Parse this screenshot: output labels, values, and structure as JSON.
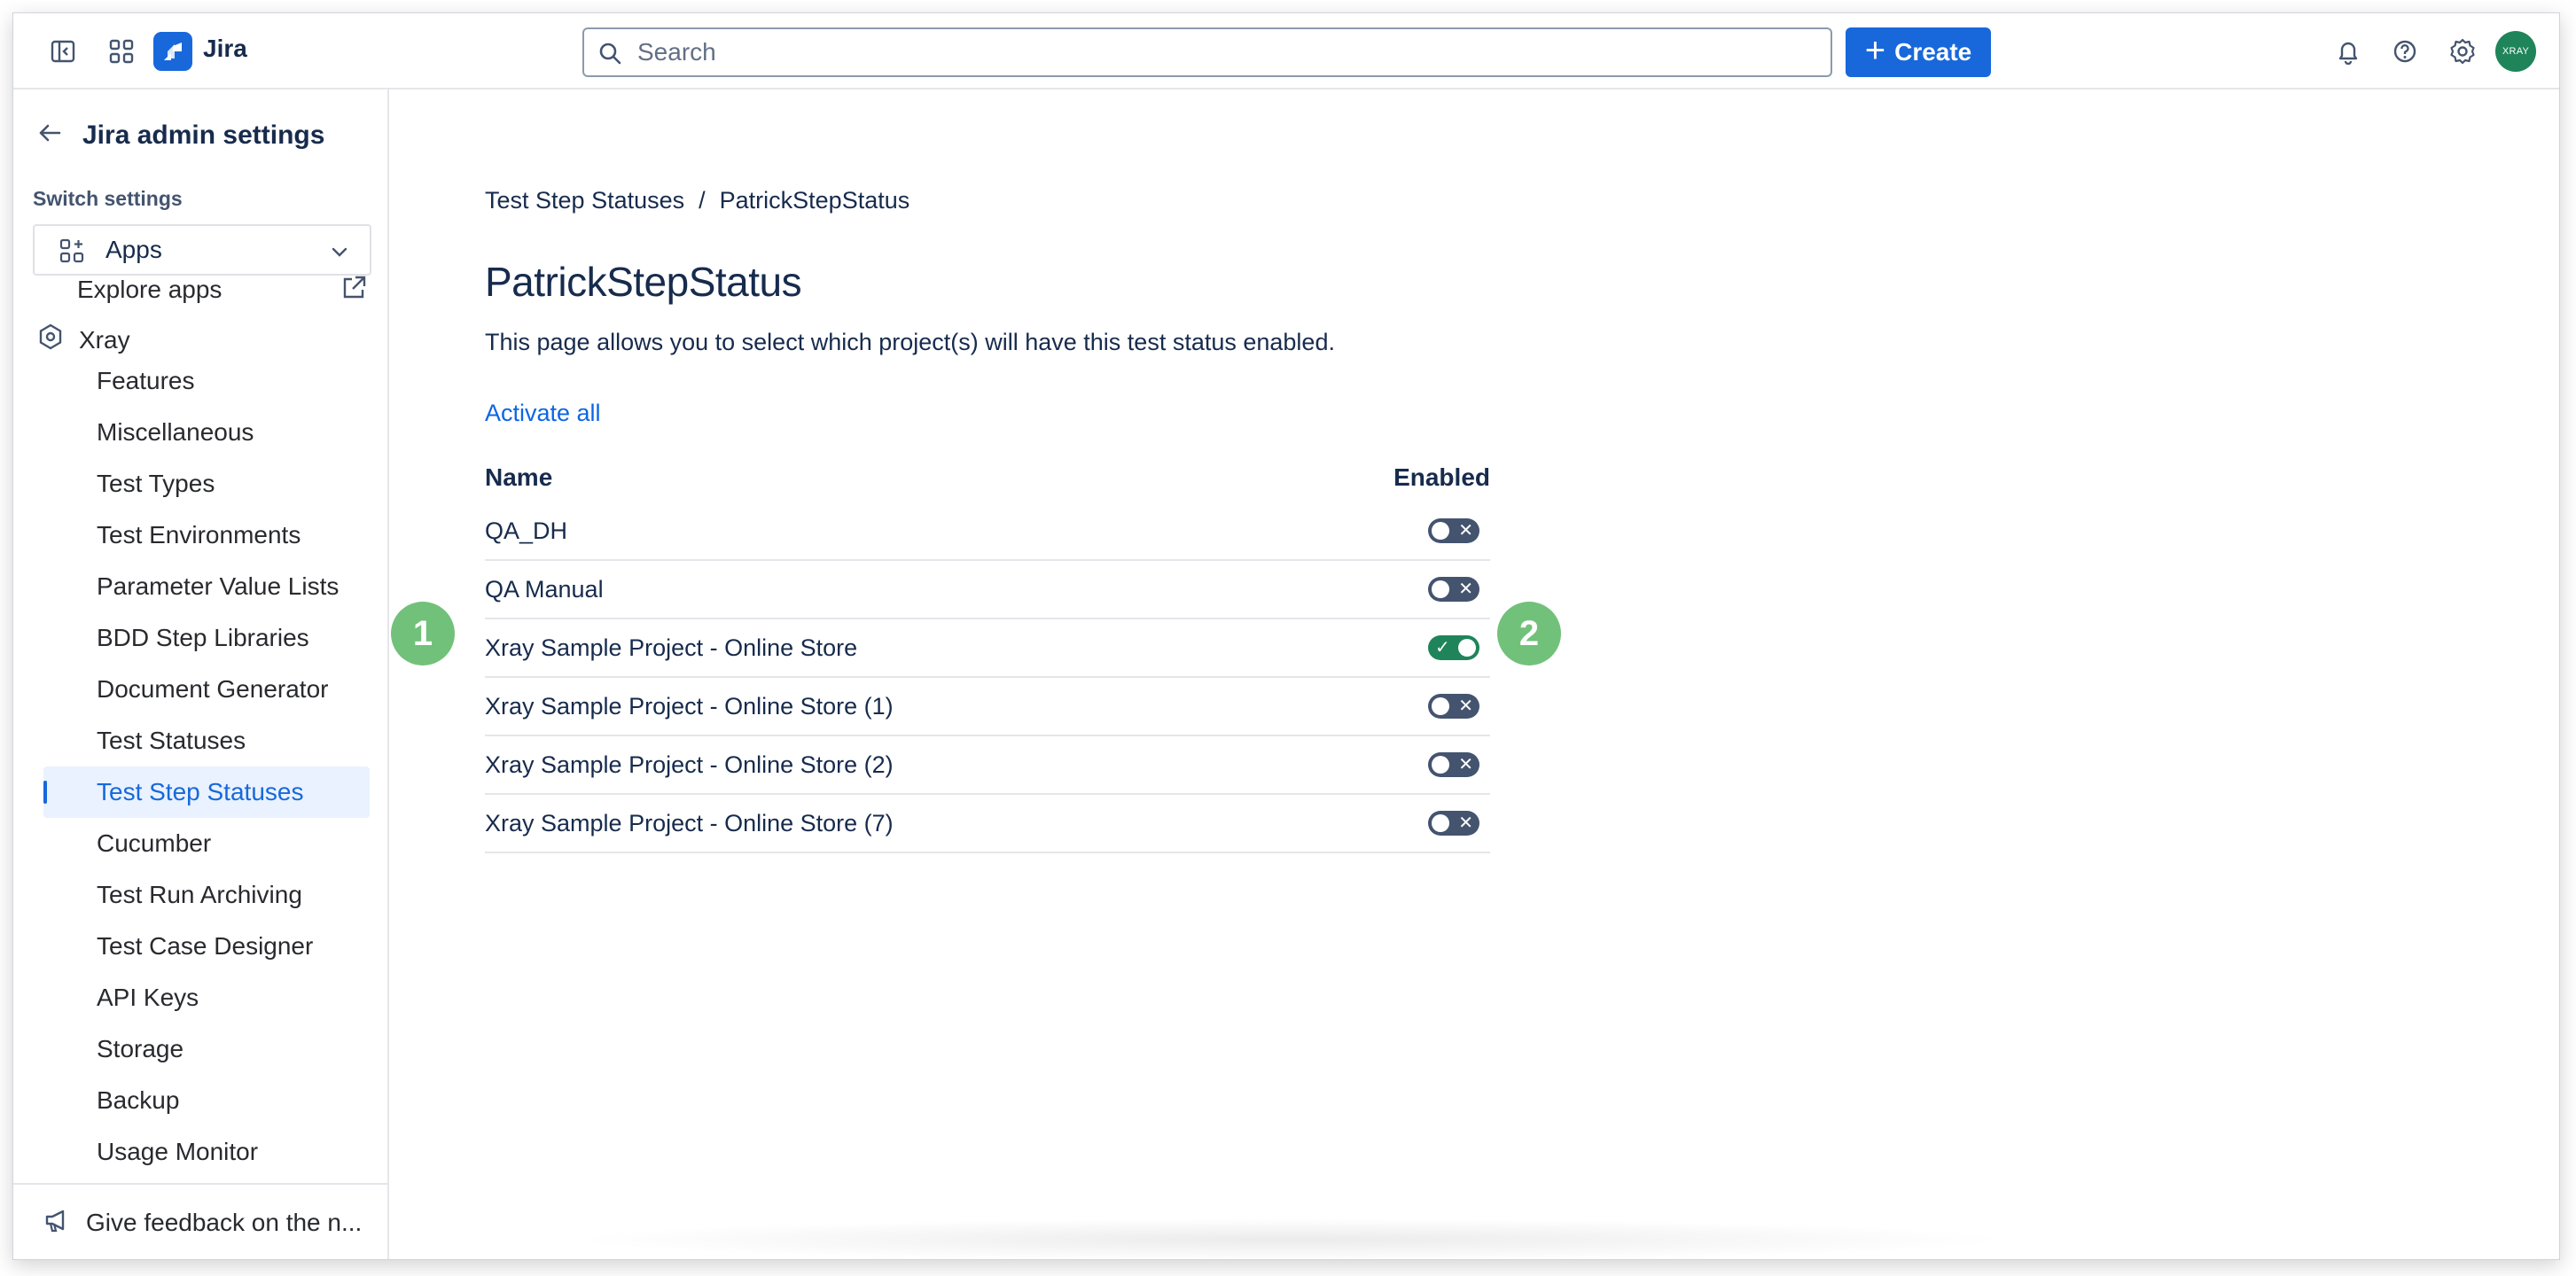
{
  "topbar": {
    "app_name": "Jira",
    "search_placeholder": "Search",
    "create_label": "Create",
    "avatar_text": "XRAY",
    "icons": [
      "sidebar-toggle-icon",
      "app-switcher-icon",
      "jira-logo-icon",
      "bell-icon",
      "help-icon",
      "settings-icon"
    ]
  },
  "sidebar": {
    "title": "Jira admin settings",
    "switch_label": "Switch settings",
    "apps_select": "Apps",
    "explore": "Explore apps",
    "xray": "Xray",
    "items": [
      {
        "label": "Features"
      },
      {
        "label": "Miscellaneous"
      },
      {
        "label": "Test Types"
      },
      {
        "label": "Test Environments"
      },
      {
        "label": "Parameter Value Lists"
      },
      {
        "label": "BDD Step Libraries"
      },
      {
        "label": "Document Generator"
      },
      {
        "label": "Test Statuses"
      },
      {
        "label": "Test Step Statuses",
        "selected": true
      },
      {
        "label": "Cucumber"
      },
      {
        "label": "Test Run Archiving"
      },
      {
        "label": "Test Case Designer"
      },
      {
        "label": "API Keys"
      },
      {
        "label": "Storage"
      },
      {
        "label": "Backup"
      },
      {
        "label": "Usage Monitor"
      }
    ],
    "feedback": "Give feedback on the n..."
  },
  "main": {
    "breadcrumb": [
      "Test Step Statuses",
      "/",
      "PatrickStepStatus"
    ],
    "title": "PatrickStepStatus",
    "description": "This page allows you to select which project(s) will have this test status enabled.",
    "activate_all": "Activate all",
    "table": {
      "col_name": "Name",
      "col_enabled": "Enabled",
      "rows": [
        {
          "name": "QA_DH",
          "enabled": false
        },
        {
          "name": "QA Manual",
          "enabled": false
        },
        {
          "name": "Xray Sample Project - Online Store",
          "enabled": true
        },
        {
          "name": "Xray Sample Project - Online Store (1)",
          "enabled": false
        },
        {
          "name": "Xray Sample Project - Online Store (2)",
          "enabled": false
        },
        {
          "name": "Xray Sample Project - Online Store (7)",
          "enabled": false
        }
      ]
    }
  },
  "annotations": [
    "1",
    "2"
  ],
  "colors": {
    "accent": "#1868db",
    "toggle_on": "#1f845a",
    "toggle_off": "#44546f",
    "badge": "#72c17a"
  }
}
